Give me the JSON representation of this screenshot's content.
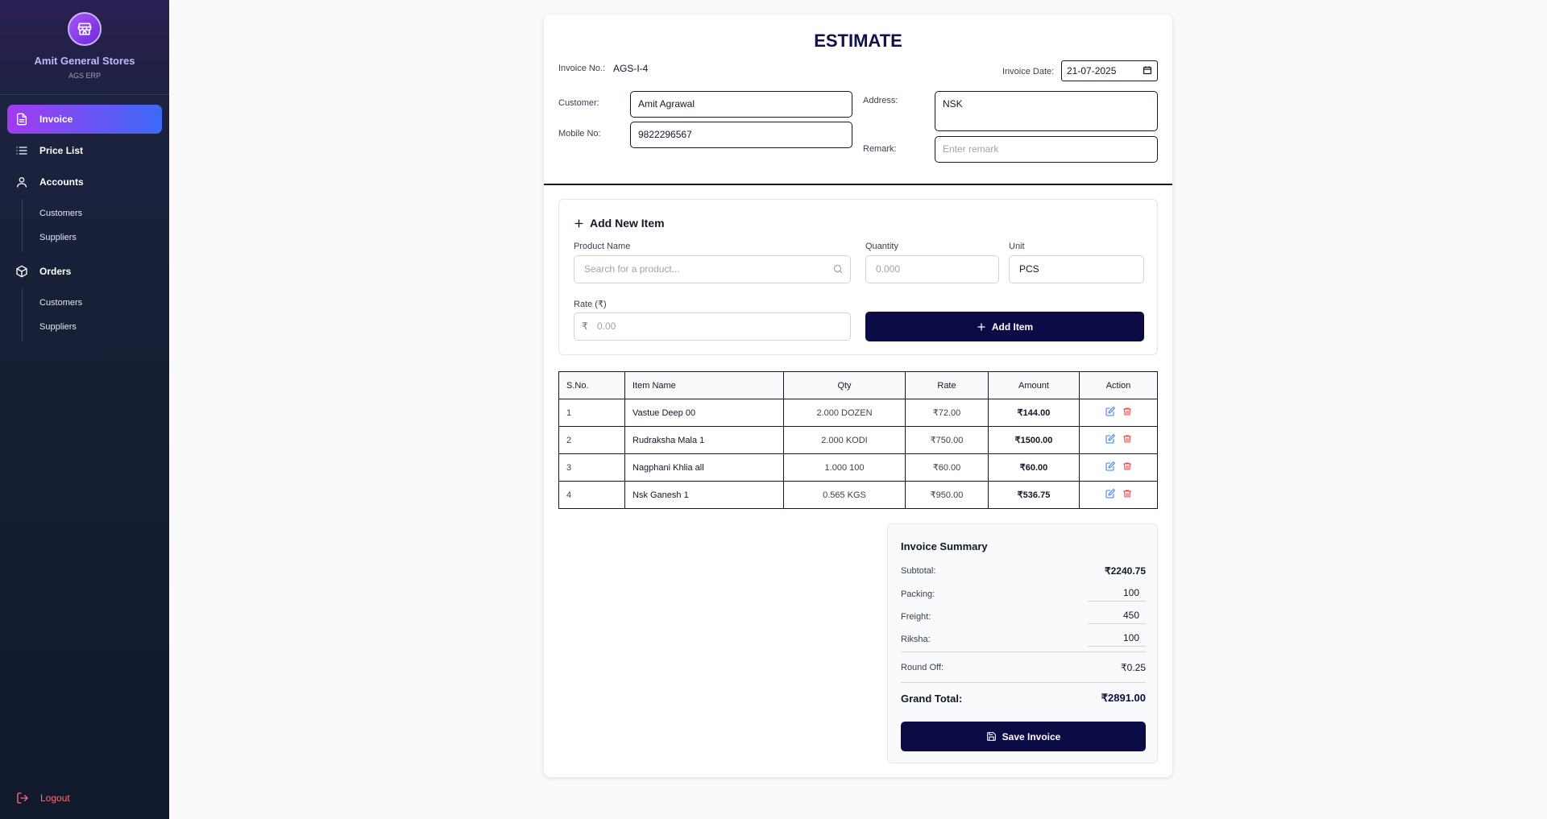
{
  "sidebar": {
    "brand_name": "Amit General Stores",
    "brand_sub": "AGS ERP",
    "items": [
      {
        "label": "Invoice"
      },
      {
        "label": "Price List"
      },
      {
        "label": "Accounts",
        "sub": [
          "Customers",
          "Suppliers"
        ]
      },
      {
        "label": "Orders",
        "sub": [
          "Customers",
          "Suppliers"
        ]
      }
    ],
    "logout": "Logout"
  },
  "invoice": {
    "title": "ESTIMATE",
    "invoice_no_label": "Invoice No.:",
    "invoice_no": "AGS-I-4",
    "date_label": "Invoice Date:",
    "date": "21-07-2025",
    "customer_label": "Customer:",
    "customer": "Amit Agrawal",
    "mobile_label": "Mobile No:",
    "mobile": "9822296567",
    "address_label": "Address:",
    "address": "NSK",
    "remark_label": "Remark:",
    "remark_placeholder": "Enter remark"
  },
  "add_item": {
    "heading": "Add New Item",
    "product_label": "Product Name",
    "product_placeholder": "Search for a product...",
    "quantity_label": "Quantity",
    "quantity_placeholder": "0.000",
    "unit_label": "Unit",
    "unit_value": "PCS",
    "rate_label": "Rate (₹)",
    "rate_symbol": "₹",
    "rate_placeholder": "0.00",
    "button": "Add Item"
  },
  "table": {
    "headers": [
      "S.No.",
      "Item Name",
      "Qty",
      "Rate",
      "Amount",
      "Action"
    ],
    "rows": [
      {
        "sn": "1",
        "name": "Vastue Deep 00",
        "qty": "2.000 DOZEN",
        "rate": "₹72.00",
        "amount": "₹144.00"
      },
      {
        "sn": "2",
        "name": "Rudraksha Mala 1",
        "qty": "2.000 KODI",
        "rate": "₹750.00",
        "amount": "₹1500.00"
      },
      {
        "sn": "3",
        "name": "Nagphani Khlia all",
        "qty": "1.000 100",
        "rate": "₹60.00",
        "amount": "₹60.00"
      },
      {
        "sn": "4",
        "name": "Nsk Ganesh 1",
        "qty": "0.565 KGS",
        "rate": "₹950.00",
        "amount": "₹536.75"
      }
    ]
  },
  "summary": {
    "title": "Invoice Summary",
    "subtotal_label": "Subtotal:",
    "subtotal": "₹2240.75",
    "packing_label": "Packing:",
    "packing": "100",
    "freight_label": "Freight:",
    "freight": "450",
    "riksha_label": "Riksha:",
    "riksha": "100",
    "roundoff_label": "Round Off:",
    "roundoff": "₹0.25",
    "grand_label": "Grand Total:",
    "grand": "₹2891.00",
    "save_button": "Save Invoice"
  },
  "colors": {
    "accent_navy": "#0b0b45",
    "active_gradient_start": "#a33af0",
    "active_gradient_end": "#3b6af6",
    "logout_red": "#f87171",
    "edit_blue": "#3b82f6",
    "delete_red": "#ef4444"
  }
}
